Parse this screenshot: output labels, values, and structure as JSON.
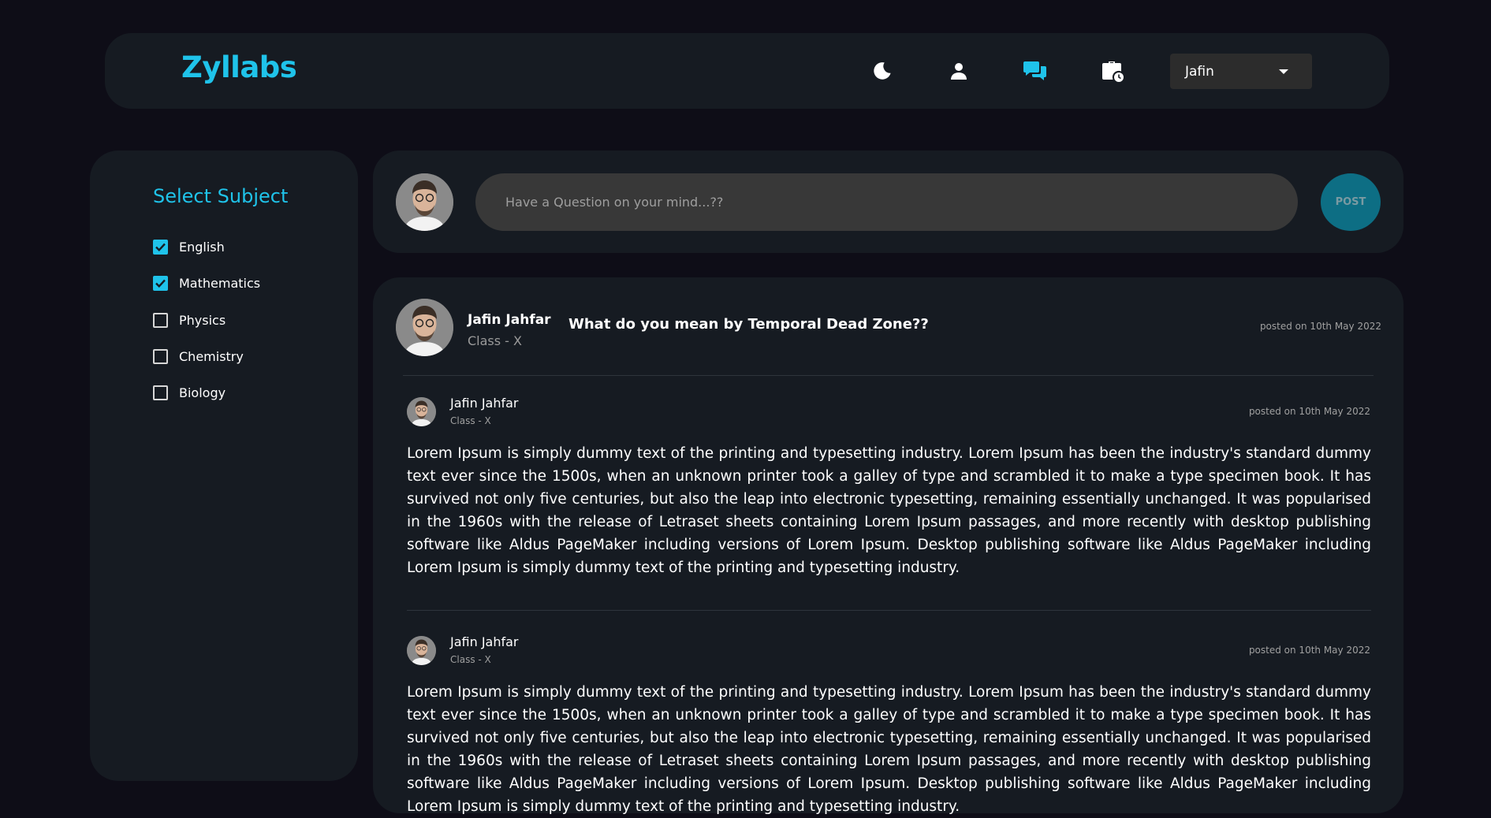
{
  "header": {
    "logo": "Zyllabs",
    "icons": [
      "moon-icon",
      "user-icon",
      "chat-icon",
      "briefcase-clock-icon"
    ],
    "user_select": {
      "value": "Jafin"
    }
  },
  "colors": {
    "accent": "#1fc3ea",
    "background": "#0e0d17",
    "card": "#161b22",
    "input": "#383838",
    "post_button": "#0d6e84"
  },
  "sidebar": {
    "title": "Select Subject",
    "subjects": [
      {
        "label": "English",
        "checked": true
      },
      {
        "label": "Mathematics",
        "checked": true
      },
      {
        "label": "Physics",
        "checked": false
      },
      {
        "label": "Chemistry",
        "checked": false
      },
      {
        "label": "Biology",
        "checked": false
      }
    ]
  },
  "ask": {
    "placeholder": "Have a Question on your mind...??",
    "post_label": "POST"
  },
  "question": {
    "author": "Jafin Jahfar",
    "class": "Class - X",
    "title": "What do you mean by Temporal Dead Zone??",
    "date": "posted on 10th May 2022"
  },
  "answers": [
    {
      "author": "Jafin Jahfar",
      "class": "Class - X",
      "date": "posted on 10th May 2022",
      "text": "Lorem Ipsum is simply dummy text of the printing and typesetting industry. Lorem Ipsum has been the industry's standard dummy text ever since the 1500s, when an unknown printer took a galley of type and scrambled it to make a type specimen book. It has survived not only five centuries, but also the leap into electronic typesetting, remaining essentially unchanged. It was popularised in the 1960s with the release of Letraset sheets containing Lorem Ipsum passages, and more recently with desktop publishing software like Aldus PageMaker including versions of Lorem Ipsum. Desktop publishing software like Aldus PageMaker including Lorem Ipsum is simply dummy text of the printing and typesetting industry."
    },
    {
      "author": "Jafin Jahfar",
      "class": "Class - X",
      "date": "posted on 10th May 2022",
      "text": "Lorem Ipsum is simply dummy text of the printing and typesetting industry. Lorem Ipsum has been the industry's standard dummy text ever since the 1500s, when an unknown printer took a galley of type and scrambled it to make a type specimen book. It has survived not only five centuries, but also the leap into electronic typesetting, remaining essentially unchanged. It was popularised in the 1960s with the release of Letraset sheets containing Lorem Ipsum passages, and more recently with desktop publishing software like Aldus PageMaker including versions of Lorem Ipsum. Desktop publishing software like Aldus PageMaker including Lorem Ipsum is simply dummy text of the printing and typesetting industry."
    }
  ]
}
